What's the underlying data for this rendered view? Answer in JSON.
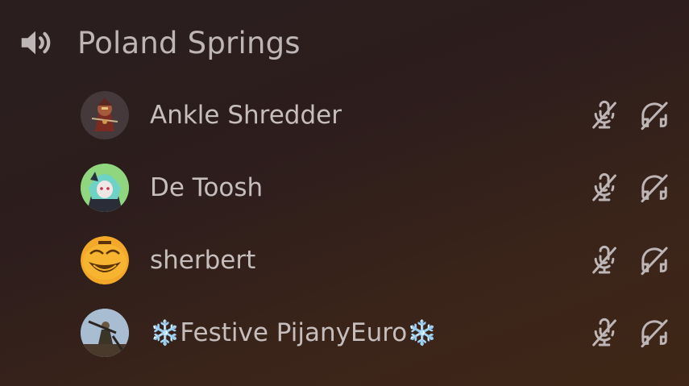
{
  "channel": {
    "name": "Poland Springs",
    "icon": "speaker-icon"
  },
  "users": [
    {
      "name": "Ankle Shredder",
      "avatar": "avatar-knight",
      "muted": true,
      "deafened": true
    },
    {
      "name": "De Toosh",
      "avatar": "avatar-anime-girl",
      "muted": true,
      "deafened": true
    },
    {
      "name": "sherbert",
      "avatar": "avatar-trollface",
      "muted": true,
      "deafened": true
    },
    {
      "name_prefix": "❄️",
      "name_core": "Festive PijanyEuro",
      "name_suffix": "❄️",
      "avatar": "avatar-soldier",
      "muted": true,
      "deafened": true
    }
  ],
  "colors": {
    "text": "#c6bebd",
    "icon": "#bdb5b6",
    "snowflake": "#a9d8f2"
  }
}
